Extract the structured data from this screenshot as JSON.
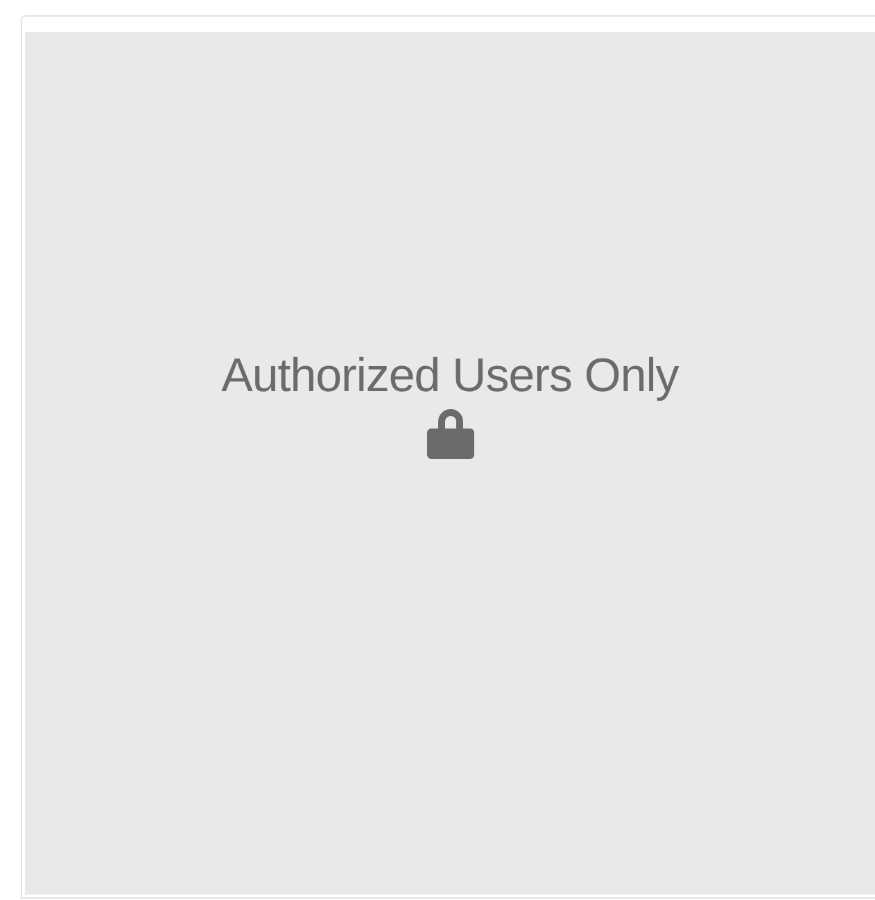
{
  "notice": {
    "message": "Authorized Users Only"
  }
}
